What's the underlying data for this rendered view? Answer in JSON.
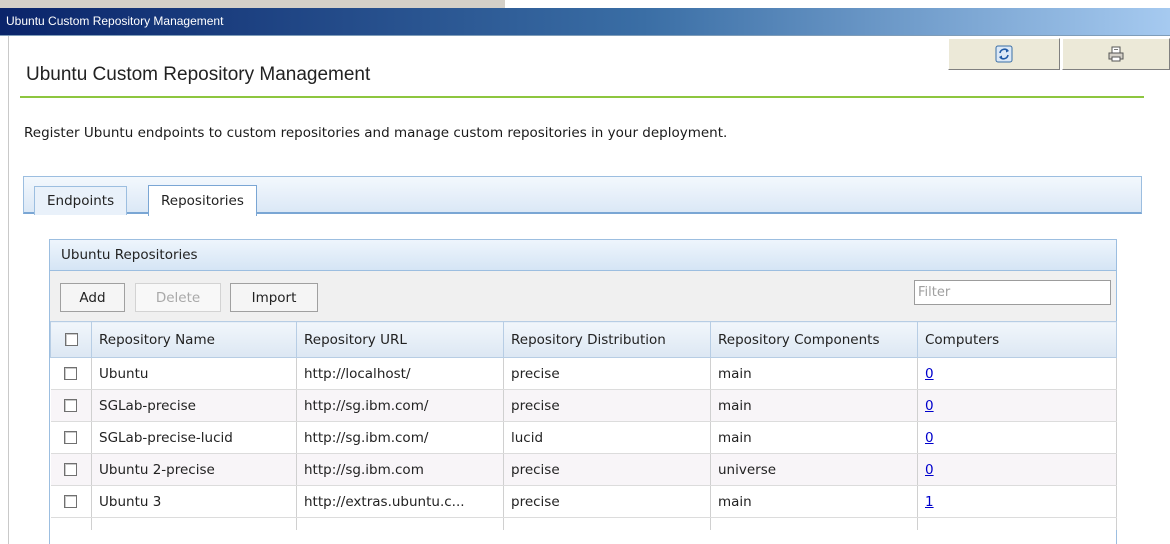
{
  "window": {
    "title": "Ubuntu Custom Repository Management"
  },
  "toolbar_icons": {
    "refresh": "refresh-icon",
    "print": "print-icon"
  },
  "page": {
    "heading": "Ubuntu Custom Repository Management",
    "description": "Register Ubuntu endpoints to custom repositories and manage custom repositories in your deployment.",
    "accent_color": "#8dc63f"
  },
  "tabs": [
    {
      "label": "Endpoints",
      "active": false
    },
    {
      "label": "Repositories",
      "active": true
    }
  ],
  "panel": {
    "title": "Ubuntu Repositories",
    "buttons": {
      "add": "Add",
      "delete": "Delete",
      "import": "Import"
    },
    "filter_placeholder": "Filter"
  },
  "table": {
    "columns": [
      "Repository Name",
      "Repository URL",
      "Repository Distribution",
      "Repository Components",
      "Computers"
    ],
    "rows": [
      {
        "name": "Ubuntu",
        "url": "http://localhost/",
        "distribution": "precise",
        "components": "main",
        "computers": "0"
      },
      {
        "name": "SGLab-precise",
        "url": "http://sg.ibm.com/",
        "distribution": "precise",
        "components": "main",
        "computers": "0"
      },
      {
        "name": "SGLab-precise-lucid",
        "url": "http://sg.ibm.com/",
        "distribution": "lucid",
        "components": "main",
        "computers": "0"
      },
      {
        "name": "Ubuntu 2-precise",
        "url": "http://sg.ibm.com",
        "distribution": "precise",
        "components": "universe",
        "computers": "0"
      },
      {
        "name": "Ubuntu 3",
        "url": "http://extras.ubuntu.c...",
        "distribution": "precise",
        "components": "main",
        "computers": "1"
      }
    ]
  }
}
